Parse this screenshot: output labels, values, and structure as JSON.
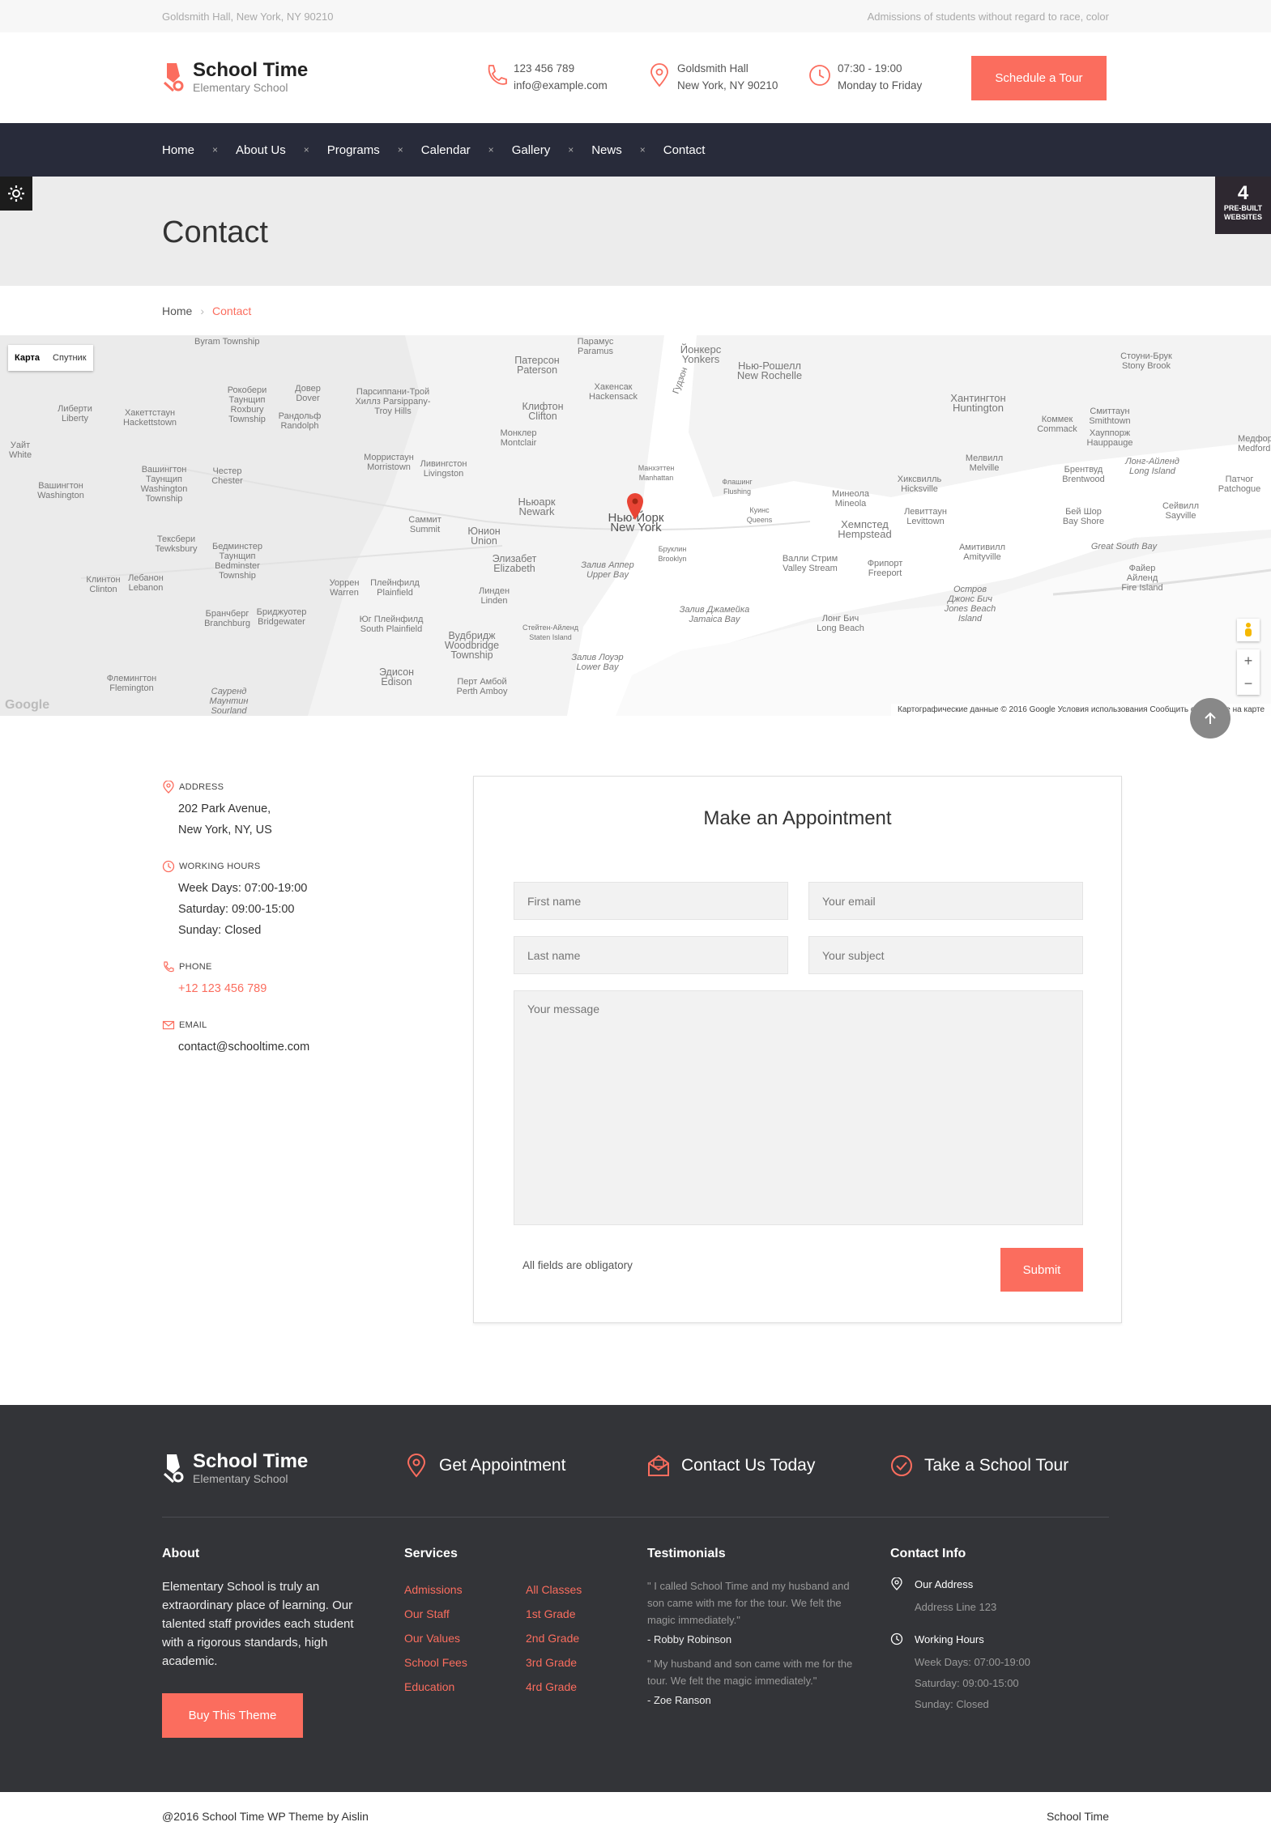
{
  "topbar": {
    "address": "Goldsmith Hall, New York, NY 90210",
    "notice": "Admissions of students without regard to race, color"
  },
  "header": {
    "logo_title": "School Time",
    "logo_subtitle": "Elementary School",
    "phone": "123 456 789",
    "email": "info@example.com",
    "addr1": "Goldsmith Hall",
    "addr2": "New York, NY 90210",
    "hours1": "07:30 - 19:00",
    "hours2": "Monday to Friday",
    "cta": "Schedule a Tour"
  },
  "nav": {
    "items": [
      "Home",
      "About Us",
      "Programs",
      "Calendar",
      "Gallery",
      "News",
      "Contact"
    ],
    "separator": "×"
  },
  "page": {
    "title": "Contact",
    "prebuilt_count": "4",
    "prebuilt_label1": "PRE-BUILT",
    "prebuilt_label2": "WEBSITES"
  },
  "breadcrumb": {
    "home": "Home",
    "separator": "›",
    "current": "Contact"
  },
  "map": {
    "type_map": "Карта",
    "type_sat": "Спутник",
    "attribution": "Картографические данные © 2016 Google   Условия использования   Сообщить об ошибке на карте",
    "google": "Google",
    "zoom_in": "+",
    "zoom_out": "−",
    "labels": [
      {
        "t": "Byram Township"
      },
      {
        "t": "Парамус Paramus"
      },
      {
        "t": "Йонкерс Yonkers"
      },
      {
        "t": "Нью-Рошелл New Rochelle"
      },
      {
        "t": "Стоуни-Брук Stony Brook"
      },
      {
        "t": "Рокобери Таунщип Roxbury Township"
      },
      {
        "t": "Довер Dover"
      },
      {
        "t": "Парсиппани-Трой Хиллз Parsippany-Troy Hills"
      },
      {
        "t": "Патерсон Paterson"
      },
      {
        "t": "Хакенсак Hackensack"
      },
      {
        "t": "Либерти Liberty"
      },
      {
        "t": "Хакеттстаун Hackettstown"
      },
      {
        "t": "Рандольф Randolph"
      },
      {
        "t": "Клифтон Clifton"
      },
      {
        "t": "Хантингтон Huntington"
      },
      {
        "t": "Смиттаун Smithtown"
      },
      {
        "t": "Уайт White"
      },
      {
        "t": "Монклер Montclair"
      },
      {
        "t": "Коммек Commack"
      },
      {
        "t": "Хауппорж Hauppauge"
      },
      {
        "t": "Медфорд Medford"
      },
      {
        "t": "Морристаун Morristown"
      },
      {
        "t": "Вашингтон Таунщип Washington Township"
      },
      {
        "t": "Честер Chester"
      },
      {
        "t": "Ливингстон Livingston"
      },
      {
        "t": "Манхэттен Manhattan"
      },
      {
        "t": "Мелвилл Melville"
      },
      {
        "t": "Вашингтон Washington"
      },
      {
        "t": "Флашинг Flushing"
      },
      {
        "t": "Хиксвилль Hicksville"
      },
      {
        "t": "Брентвуд Brentwood"
      },
      {
        "t": "Лонг-Айленд Long Island"
      },
      {
        "t": "Патчог Patchogue"
      },
      {
        "t": "Ньюарк Newark"
      },
      {
        "t": "Нью-Йорк New York"
      },
      {
        "t": "Минеола Mineola"
      },
      {
        "t": "Куинс Queens"
      },
      {
        "t": "Левиттаун Levittown"
      },
      {
        "t": "Бей Шор Bay Shore"
      },
      {
        "t": "Сейвилл Sayville"
      },
      {
        "t": "Саммит Summit"
      },
      {
        "t": "Юнион Union"
      },
      {
        "t": "Хемпстед Hempstead"
      },
      {
        "t": "Тексбери Tewksbury"
      },
      {
        "t": "Бедминстер Таунщип Bedminster Township"
      },
      {
        "t": "Элизабет Elizabeth"
      },
      {
        "t": "Бруклин Brooklyn"
      },
      {
        "t": "Амитивилл Amityville"
      },
      {
        "t": "Great South Bay"
      },
      {
        "t": "Клинтон Clinton"
      },
      {
        "t": "Лебанон Lebanon"
      },
      {
        "t": "Залив Аппер Upper Bay"
      },
      {
        "t": "Валли Стрим Valley Stream"
      },
      {
        "t": "Фрипорт Freeport"
      },
      {
        "t": "Файер Айленд Fire Island"
      },
      {
        "t": "Уоррен Warren"
      },
      {
        "t": "Плейнфилд Plainfield"
      },
      {
        "t": "Линден Linden"
      },
      {
        "t": "Остров Джонс Бич Jones Beach Island"
      },
      {
        "t": "Бранчберг Branchburg"
      },
      {
        "t": "Бриджуотер Bridgewater"
      },
      {
        "t": "Юг Плейнфилд South Plainfield"
      },
      {
        "t": "Стейтен-Айленд Staten Island"
      },
      {
        "t": "Залив Джамейка Jamaica Bay"
      },
      {
        "t": "Лонг Бич Long Beach"
      },
      {
        "t": "Вудбридж Woodbridge Township"
      },
      {
        "t": "Залив Лоуэр Lower Bay"
      },
      {
        "t": "Флемингтон Flemington"
      },
      {
        "t": "Эдисон Edison"
      },
      {
        "t": "Перт Амбой Perth Amboy"
      },
      {
        "t": "Сауренд Маунтин Sourland"
      },
      {
        "t": "Гудзон"
      }
    ]
  },
  "contact": {
    "address_label": "ADDRESS",
    "address1": "202 Park Avenue,",
    "address2": "New York, NY, US",
    "hours_label": "WORKING HOURS",
    "hours1": "Week Days: 07:00-19:00",
    "hours2": "Saturday: 09:00-15:00",
    "hours3": "Sunday: Closed",
    "phone_label": "PHONE",
    "phone": "+12 123 456 789",
    "email_label": "EMAIL",
    "email": "contact@schooltime.com"
  },
  "form": {
    "title": "Make an Appointment",
    "first_name": "First name",
    "email": "Your email",
    "last_name": "Last name",
    "subject": "Your subject",
    "message": "Your message",
    "note": "All fields are obligatory",
    "submit": "Submit"
  },
  "footer": {
    "logo_title": "School Time",
    "logo_subtitle": "Elementary School",
    "action1": "Get Appointment",
    "action2": "Contact Us Today",
    "action3": "Take a School Tour",
    "about_title": "About",
    "about_text": "Elementary School is truly an extraordinary place of learning. Our talented staff provides each student with a rigorous standards, high academic.",
    "buy": "Buy This Theme",
    "services_title": "Services",
    "services_col1": [
      "Admissions",
      "Our Staff",
      "Our Values",
      "School Fees",
      "Education"
    ],
    "services_col2": [
      "All Classes",
      "1st Grade",
      "2nd Grade",
      "3rd Grade",
      "4rd Grade"
    ],
    "testimonials_title": "Testimonials",
    "t1_text": "\" I called School Time and my husband and son came with me for the tour. We felt the magic immediately.\"",
    "t1_author": "- Robby Robinson",
    "t2_text": "\" My husband and son came with me for the tour. We felt the magic immediately.\"",
    "t2_author": "- Zoe Ranson",
    "contact_title": "Contact Info",
    "our_address": "Our Address",
    "address_line": "Address Line 123",
    "working_hours": "Working Hours",
    "wh1": "Week Days: 07:00-19:00",
    "wh2": "Saturday: 09:00-15:00",
    "wh3": "Sunday: Closed"
  },
  "copyright": {
    "left": "@2016 School Time WP Theme by Aislin",
    "right": "School Time"
  },
  "colors": {
    "accent": "#fb6d5e",
    "nav_bg": "#282b3a",
    "footer_bg": "#333438"
  }
}
